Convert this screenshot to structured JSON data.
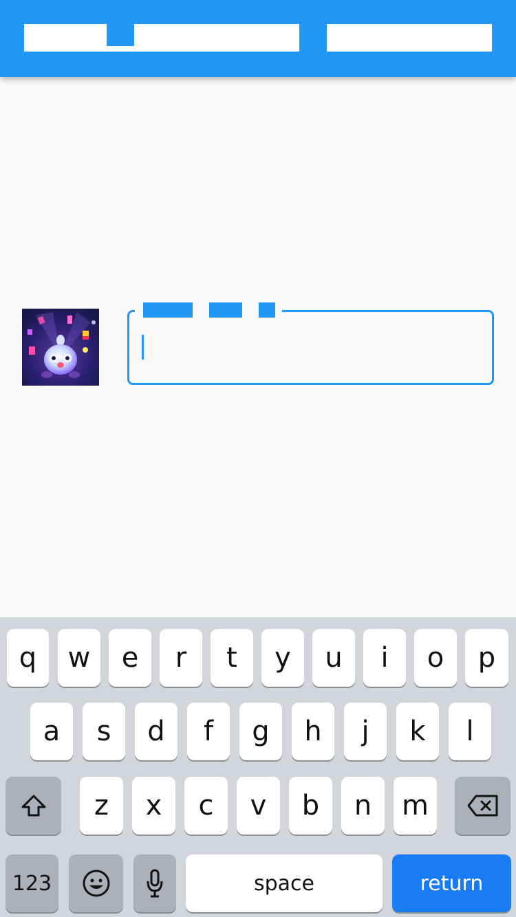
{
  "app_bar": {
    "color": "#2196f3"
  },
  "text_field": {
    "value": "",
    "border_color": "#2196f3"
  },
  "keyboard": {
    "row1": [
      "q",
      "w",
      "e",
      "r",
      "t",
      "y",
      "u",
      "i",
      "o",
      "p"
    ],
    "row2": [
      "a",
      "s",
      "d",
      "f",
      "g",
      "h",
      "j",
      "k",
      "l"
    ],
    "row3": [
      "z",
      "x",
      "c",
      "v",
      "b",
      "n",
      "m"
    ],
    "numbers_label": "123",
    "space_label": "space",
    "return_label": "return",
    "icons": [
      "shift-icon",
      "backspace-icon",
      "emoji-icon",
      "microphone-icon"
    ]
  }
}
